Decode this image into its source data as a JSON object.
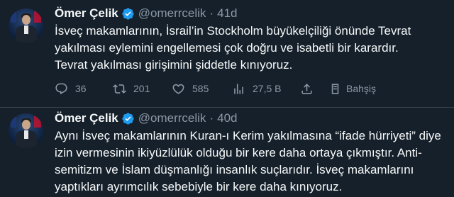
{
  "tweets": [
    {
      "name": "Ömer Çelik",
      "handle": "@omerrcelik",
      "separator": "·",
      "time": "41d",
      "lines": [
        "İsveç makamlarının, İsrail’in Stockholm büyükelçiliği önünde Tevrat",
        "yakılması eylemini engellemesi çok doğru ve isabetli bir karardır.",
        "Tevrat yakılması girişimini şiddetle kınıyoruz."
      ],
      "actions": {
        "replies": "36",
        "retweets": "201",
        "likes": "585",
        "views": "27,5 B",
        "tip_label": "Bahşiş"
      }
    },
    {
      "name": "Ömer Çelik",
      "handle": "@omerrcelik",
      "separator": "·",
      "time": "40d",
      "lines": [
        "Aynı İsveç makamlarının Kuran-ı Kerim yakılmasına “ifade hürriyeti” diye",
        "izin vermesinin ikiyüzlülük olduğu bir kere daha ortaya çıkmıştır. Anti-",
        "semitizm ve İslam düşmanlığı insanlık suçlarıdır. İsveç makamlarını",
        "yaptıkları ayrımcılık sebebiyle bir kere daha kınıyoruz."
      ]
    }
  ],
  "colors": {
    "background": "#15202b",
    "text": "#f7f9f9",
    "secondary": "#8b98a5",
    "verified": "#1d9bf0",
    "divider": "#38444d"
  },
  "icons": [
    "reply-icon",
    "retweet-icon",
    "like-icon",
    "views-icon",
    "share-icon",
    "tip-icon",
    "verified-badge-icon"
  ]
}
